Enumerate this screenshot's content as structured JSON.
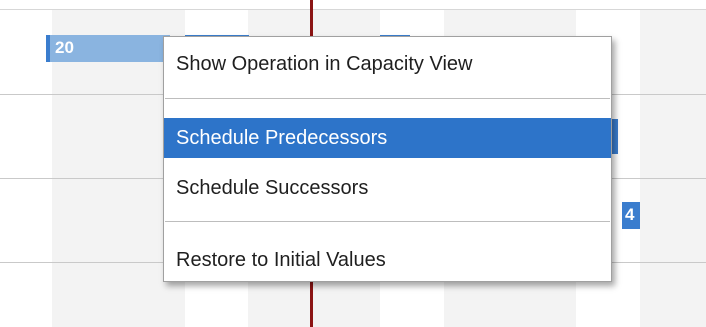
{
  "gantt": {
    "bars": [
      {
        "label": "20"
      },
      {
        "label": ""
      },
      {
        "label": "4"
      }
    ]
  },
  "context_menu": {
    "items": [
      {
        "label": "Show Operation in Capacity View",
        "selected": false
      },
      {
        "label": "Schedule Predecessors",
        "selected": true
      },
      {
        "label": "Schedule Successors",
        "selected": false
      },
      {
        "label": "Restore to Initial Values",
        "selected": false
      }
    ]
  },
  "colors": {
    "selection": "#2d74c9",
    "bar_light": "#8ab4e0",
    "bar_dark": "#3a7dce",
    "today_line": "#8b1414"
  }
}
